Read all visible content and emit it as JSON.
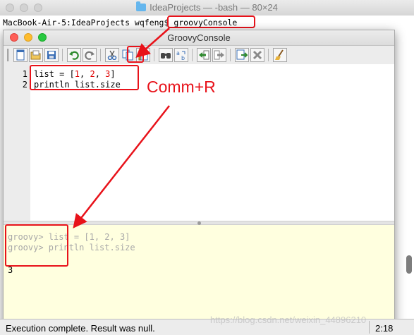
{
  "terminal": {
    "title": "IdeaProjects — -bash — 80×24",
    "prompt": "MacBook-Air-5:IdeaProjects wqfeng$ ",
    "command": "groovyConsole"
  },
  "console": {
    "title": "GroovyConsole",
    "toolbar": [
      {
        "name": "new-file-icon"
      },
      {
        "name": "open-folder-icon"
      },
      {
        "name": "save-icon"
      },
      {
        "name": "undo-icon"
      },
      {
        "name": "redo-icon"
      },
      {
        "name": "cut-icon"
      },
      {
        "name": "copy-icon"
      },
      {
        "name": "paste-icon"
      },
      {
        "name": "find-icon"
      },
      {
        "name": "replace-icon"
      },
      {
        "name": "history-prev-icon"
      },
      {
        "name": "history-next-icon"
      },
      {
        "name": "run-script-icon"
      },
      {
        "name": "interrupt-icon"
      },
      {
        "name": "clear-output-icon"
      }
    ],
    "editor": {
      "lines": [
        {
          "number": "1",
          "text": "list = [1, 2, 3]"
        },
        {
          "number": "2",
          "text": "println list.size"
        }
      ]
    },
    "output": {
      "prompt_lines": [
        "groovy> list = [1, 2, 3]",
        "groovy> println list.size"
      ],
      "result": "3"
    },
    "status": {
      "message": "Execution complete. Result was null.",
      "position": "2:18"
    }
  },
  "annotation": {
    "label": "Comm+R",
    "color": "#e8121a"
  },
  "watermark": "https://blog.csdn.net/weixin_44896210"
}
